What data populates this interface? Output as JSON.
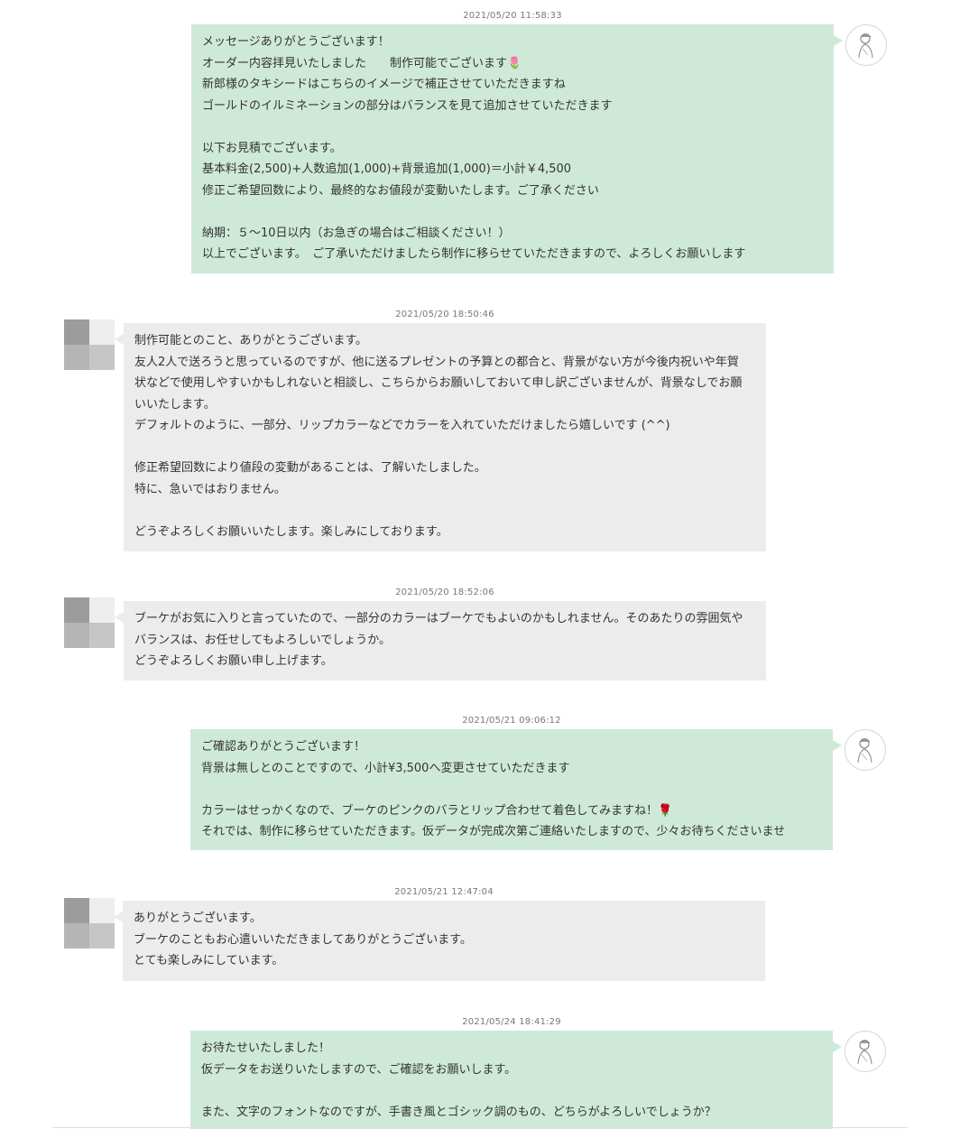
{
  "messages": [
    {
      "sender": "me",
      "timestamp": "2021/05/20 11:58:33",
      "text": "メッセージありがとうございます！\nオーダー内容拝見いたしました　　制作可能でございます🌷\n新郎様のタキシードはこちらのイメージで補正させていただきますね\nゴールドのイルミネーションの部分はバランスを見て追加させていただきます\n\n以下お見積でございます。\n基本料金(2,500)+人数追加(1,000)+背景追加(1,000)＝小計￥4,500\n修正ご希望回数により、最終的なお値段が変動いたします。ご了承ください\n\n納期：５〜10日以内（お急ぎの場合はご相談ください！）\n以上でございます。　ご了承いただけましたら制作に移らせていただきますので、よろしくお願いします"
    },
    {
      "sender": "client",
      "timestamp": "2021/05/20 18:50:46",
      "text": "制作可能とのこと、ありがとうございます。\n友人2人で送ろうと思っているのですが、他に送るプレゼントの予算との都合と、背景がない方が今後内祝いや年賀\n状などで使用しやすいかもしれないと相談し、こちらからお願いしておいて申し訳ございませんが、背景なしでお願\nいいたします。\nデフォルトのように、一部分、リップカラーなどでカラーを入れていただけましたら嬉しいです (^^)\n\n修正希望回数により値段の変動があることは、了解いたしました。\n特に、急いではおりません。\n\nどうぞよろしくお願いいたします。楽しみにしております。"
    },
    {
      "sender": "client",
      "timestamp": "2021/05/20 18:52:06",
      "text": "ブーケがお気に入りと言っていたので、一部分のカラーはブーケでもよいのかもしれません。そのあたりの雰囲気や\nバランスは、お任せしてもよろしいでしょうか。\nどうぞよろしくお願い申し上げます。"
    },
    {
      "sender": "me",
      "timestamp": "2021/05/21 09:06:12",
      "text": "ご確認ありがとうございます！\n背景は無しとのことですので、小計¥3,500へ変更させていただきます\n\nカラーはせっかくなので、ブーケのピンクのバラとリップ合わせて着色してみますね！🌹\nそれでは、制作に移らせていただきます。仮データが完成次第ご連絡いたしますので、少々お待ちくださいませ"
    },
    {
      "sender": "client",
      "timestamp": "2021/05/21 12:47:04",
      "text": "ありがとうございます。\nブーケのこともお心遣いいただきましてありがとうございます。\nとても楽しみにしています。"
    },
    {
      "sender": "me",
      "timestamp": "2021/05/24 18:41:29",
      "text": "お待たせいたしました！\n仮データをお送りいたしますので、ご確認をお願いします。\n\nまた、文字のフォントなのですが、手書き風とゴシック調のもの、どちらがよろしいでしょうか？"
    }
  ],
  "colors": {
    "mine_bubble": "#cfe9d9",
    "client_bubble": "#ececec",
    "timestamp": "#777777"
  },
  "icons": {
    "mine_avatar": "illustrated-woman-avatar-icon",
    "client_avatar": "pixelated-avatar-icon"
  }
}
